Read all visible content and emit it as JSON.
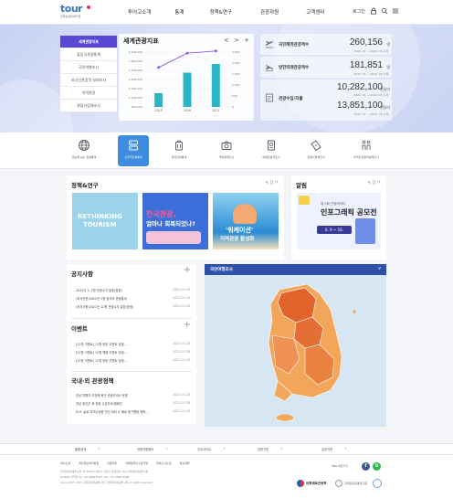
{
  "header": {
    "logo_word": "tour",
    "logo_sub": "한국관광데이터랩",
    "nav": [
      "투어고소개",
      "통계",
      "정책&연구",
      "관광자원",
      "고객센터"
    ],
    "login_label": "로그인"
  },
  "sidebar": {
    "items": [
      {
        "label": "세계관광지표",
        "active": true
      },
      {
        "label": "출입국관광통계",
        "active": false
      },
      {
        "label": "국민여행조사",
        "active": false
      },
      {
        "label": "외국인관광객 실태조사",
        "active": false
      },
      {
        "label": "지역관광",
        "active": false
      },
      {
        "label": "관광사업체조사",
        "active": false
      }
    ]
  },
  "indicator_card": {
    "title": "세계관광지표",
    "ctrl_prev": "<",
    "ctrl_next": ">",
    "ctrl_add": "+"
  },
  "chart_data": {
    "type": "bar",
    "categories": [
      "2015",
      "2016",
      "2017"
    ],
    "series": [
      {
        "values": [
          1200000,
          1650000,
          1840000
        ],
        "color": "#2bb6c5"
      },
      {
        "values": [
          1800,
          2450,
          2550
        ],
        "color": "#8e5be8"
      }
    ],
    "y_left_ticks": [
      "2,100,000",
      "1,900,000",
      "1,700,000",
      "1,500,000",
      "1,300,000",
      "1,100,000",
      "900,000"
    ],
    "y_right_ticks": [
      "2,500",
      "2,000",
      "1,500",
      "1,000",
      "500",
      "0"
    ],
    "ylim_left": [
      900000,
      2100000
    ],
    "ylim_right": [
      0,
      2500
    ],
    "grid": true
  },
  "stats": [
    {
      "label": "국민해외관광객수",
      "value": "260,156",
      "unit": "명",
      "note": "2022. 01 ~ 2022. 05 누계",
      "icon": "airplane-depart-icon"
    },
    {
      "label": "방한외래관광객수",
      "value": "181,851",
      "unit": "명",
      "note": "2022. 01 ~ 2022. 05 누계",
      "icon": "airplane-arrive-icon"
    },
    {
      "label": "관광수입",
      "value": "10,282,100",
      "unit": "천달러",
      "note": "2022. 01 ~ 2022. 04 누계",
      "icon": "receipt-icon"
    },
    {
      "label": "관광지출",
      "value": "13,851,100",
      "unit": "천달러",
      "note": "2022. 01 ~ 2022. 04 누계",
      "icon": "receipt-icon"
    }
  ],
  "stats_label_pair": "관광수입/지출",
  "quick_menu": [
    {
      "label": "한눈에 보는 관광통계",
      "icon": "globe-icon",
      "active": false
    },
    {
      "label": "출입국관광통계",
      "icon": "server-icon",
      "active": true
    },
    {
      "label": "입국관광통계",
      "icon": "suitcase-icon",
      "active": false
    },
    {
      "label": "국민여행조사",
      "icon": "camera-icon",
      "active": false
    },
    {
      "label": "외래관광객조사",
      "icon": "passport-icon",
      "active": false
    },
    {
      "label": "관광사업체조사",
      "icon": "ticket-icon",
      "active": false
    },
    {
      "label": "외국인관광객실태조사",
      "icon": "people-icon",
      "active": false
    }
  ],
  "policy": {
    "title": "정책&연구",
    "ctrl": "< || >",
    "cards": [
      {
        "line1": "RETHINKING",
        "line2": "TOURISM"
      },
      {
        "line1": "한국관광,",
        "line2": "얼마나 회복되었나?"
      },
      {
        "line1": "'워케이션'",
        "line2": "지역관광 활성화"
      }
    ]
  },
  "notice_panel": {
    "title": "알림",
    "ctrl": "< || >",
    "poster_top": "제 2회 관광데이터",
    "poster_main": "인포그래픽 공모전",
    "poster_date": "6. 9 ~ 18."
  },
  "announcements": {
    "title": "공지사항",
    "rows": [
      {
        "text": "2022년 1, 2월 관광수지 발표(잠정)",
        "date": "2022.03.28"
      },
      {
        "text": "(외국인관)2022년 2월 한국의 관광통계",
        "date": "2022.03.28"
      },
      {
        "text": "(공지사항)2021년 12월 관광수지 발표(잠정)",
        "date": "2022.03.28"
      }
    ]
  },
  "events": {
    "title": "이벤트",
    "rows": [
      {
        "text": "[12월 이벤트] 12월 방방 이벤트 당첨...",
        "date": "2022.03.28"
      },
      {
        "text": "[12월 이벤트] 12월 펜팔 이벤트 당첨...",
        "date": "2022.03.28"
      },
      {
        "text": "[12월 이벤트] 12월 방방 이벤트 당첨...",
        "date": "2022.03.28"
      }
    ]
  },
  "research": {
    "title": "국내·외 관광정책",
    "rows": [
      {
        "text": "전남 여행지 오전에 퇴근 관광안내소 운영",
        "date": "2022.03.28"
      },
      {
        "text": "전남 정선군 제 관광 수호자세 캠페인",
        "date": "2022.03.28"
      },
      {
        "text": "EU+ 글로 여객수송량 전년 대비 두 배로 증가했음 예측...",
        "date": "2022.03.28"
      }
    ]
  },
  "map_panel": {
    "title": "국민여행조사",
    "chevron": "v"
  },
  "footer_nav": [
    "통합검색",
    "관광자원정보",
    "주요사이트",
    "관련기관",
    "유관기관"
  ],
  "footer": {
    "links": [
      "회사소개",
      "개인정보처리방침",
      "이용약관",
      "이메일무단수집거부",
      "찾아오시는길",
      "정보개방"
    ],
    "addr1": "한국문화관광연구원 (우)07511 서울시 강서구 공항대로 154 한국문화관광연구원",
    "addr2": "TouRGo 사업팀 Tel : 02-2669-8927, Fax : 02-2669-9008",
    "copyright": "Copyright© 2021 한국문화관광연구원 / 한국문화관광연구원 All rights reserved",
    "sns_label": "SNS 바로가기",
    "org1": "문화체육관광부",
    "org2": "한국문화관광연구원"
  },
  "colors": {
    "accent": "#5b47d6",
    "teal": "#2bb6c5",
    "purple": "#8e5be8",
    "map_dark": "#e2622b",
    "map_light": "#f2a65a"
  }
}
